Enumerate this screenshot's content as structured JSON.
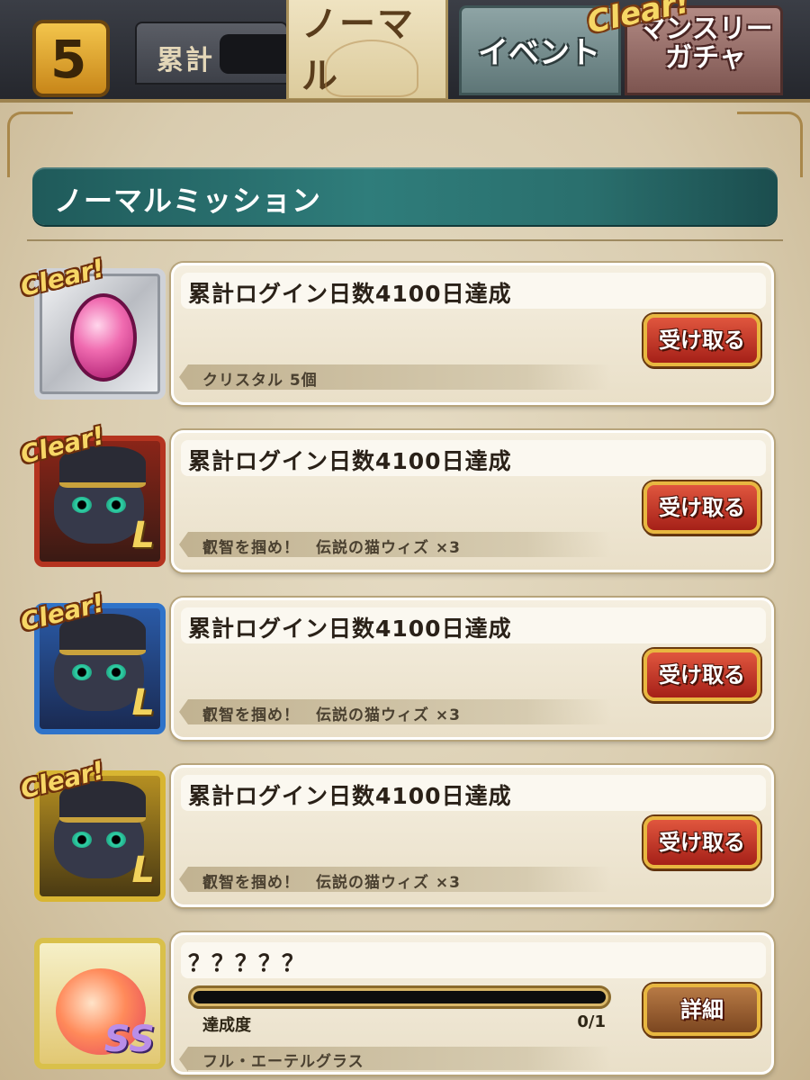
{
  "top_tabs": {
    "back_glyph": "5",
    "total_label": "累計",
    "normal_label": "ノーマル",
    "event_label": "イベント",
    "monthly_gacha_label": "マンスリーガチャ",
    "monthly_clear_badge": "Clear!"
  },
  "section": {
    "title": "ノーマルミッション"
  },
  "missions": [
    {
      "clear_badge": "Clear!",
      "title": "累計ログイン日数4100日達成",
      "reward": "クリスタル 5個",
      "button": "受け取る",
      "icon": "crystal-gem-icon"
    },
    {
      "clear_badge": "Clear!",
      "title": "累計ログイン日数4100日達成",
      "reward": "叡智を掴め！　伝説の猫ウィズ ×3",
      "button": "受け取る",
      "icon": "black-cat-red-frame-icon"
    },
    {
      "clear_badge": "Clear!",
      "title": "累計ログイン日数4100日達成",
      "reward": "叡智を掴め！　伝説の猫ウィズ ×3",
      "button": "受け取る",
      "icon": "black-cat-blue-frame-icon"
    },
    {
      "clear_badge": "Clear!",
      "title": "累計ログイン日数4100日達成",
      "reward": "叡智を掴め！　伝説の猫ウィズ ×3",
      "button": "受け取る",
      "icon": "black-cat-gold-frame-icon"
    },
    {
      "title": "？？？？？",
      "progress_label": "達成度",
      "progress_count": "0/1",
      "progress_value": 0,
      "reward": "フル・エーテルグラス",
      "button": "詳細",
      "icon": "fairy-orb-icon"
    }
  ],
  "colors": {
    "parchment": "#e6dcc4",
    "header_teal": "#2f7d7b",
    "button_red": "#c43a26",
    "button_brown": "#9a5f32",
    "button_border_gold": "#e8b740"
  }
}
